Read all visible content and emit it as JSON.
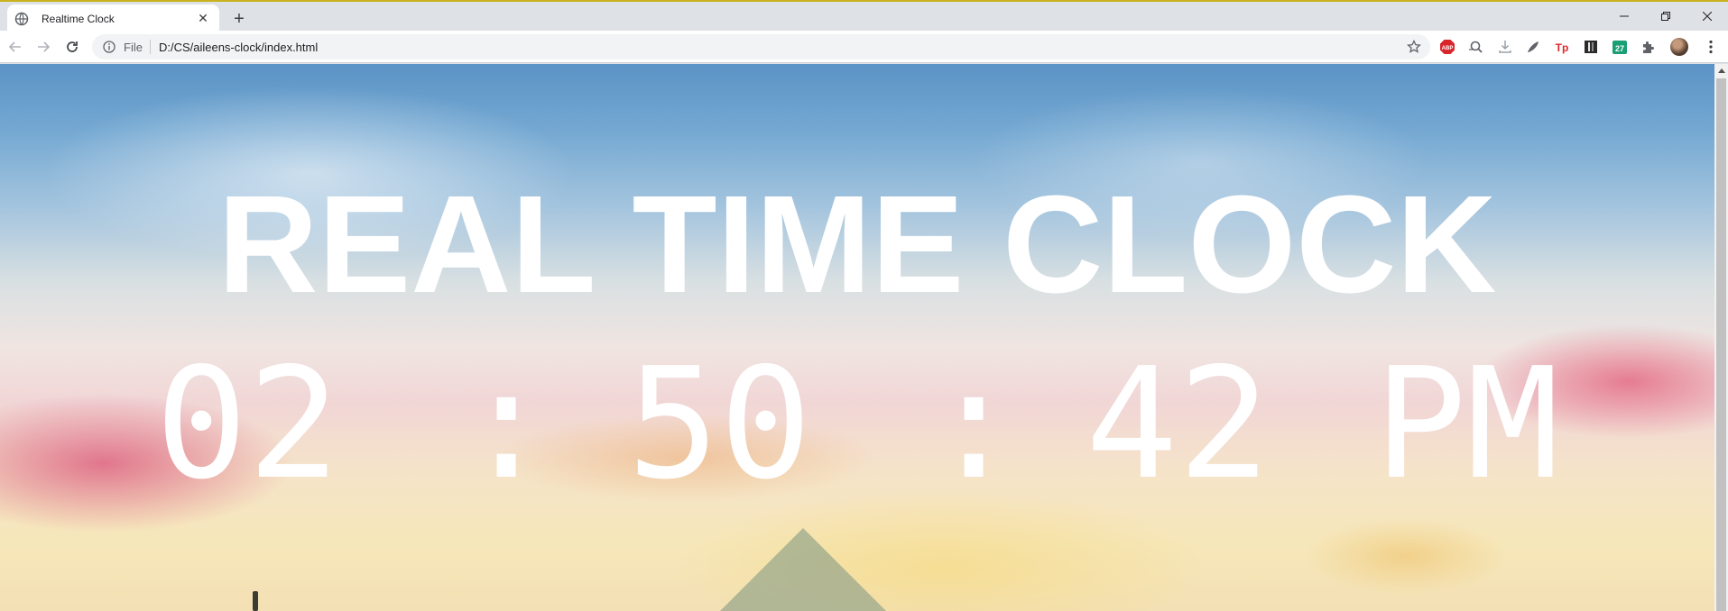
{
  "browser": {
    "tab": {
      "title": "Realtime Clock",
      "favicon": "globe-icon"
    },
    "omnibox": {
      "scheme_label": "File",
      "url": "D:/CS/aileens-clock/index.html"
    },
    "extensions": [
      {
        "name": "adblock-plus-icon",
        "label": "ABP",
        "color": "#d9262b"
      },
      {
        "name": "search-extension-icon"
      },
      {
        "name": "download-extension-icon"
      },
      {
        "name": "pen-extension-icon"
      },
      {
        "name": "tp-extension-icon",
        "label": "Tp",
        "color": "#e0262b"
      },
      {
        "name": "book-extension-icon"
      },
      {
        "name": "calendar-extension-icon",
        "label": "27",
        "color": "#1a9e73"
      },
      {
        "name": "puzzle-icon"
      }
    ],
    "accent_color": "#c9b21b"
  },
  "page": {
    "heading": "REAL TIME CLOCK",
    "clock": {
      "hours": "02",
      "separator": ":",
      "minutes": "50",
      "seconds": "42",
      "period": "PM"
    },
    "text_color": "#ffffff"
  }
}
